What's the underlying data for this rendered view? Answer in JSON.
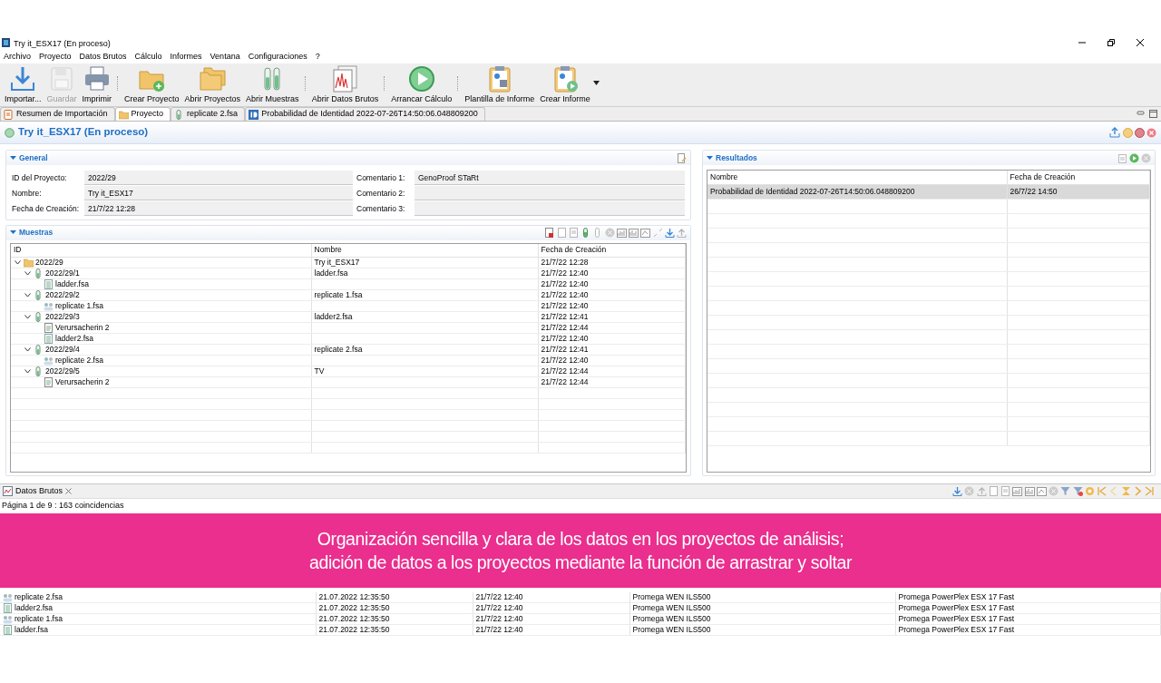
{
  "window": {
    "title": "Try it_ESX17 (En proceso)"
  },
  "menu": [
    "Archivo",
    "Proyecto",
    "Datos Brutos",
    "Cálculo",
    "Informes",
    "Ventana",
    "Configuraciones",
    "?"
  ],
  "toolbar": [
    {
      "label": "Importar...",
      "disabled": false,
      "separator_after": false
    },
    {
      "label": "Guardar",
      "disabled": true,
      "separator_after": false
    },
    {
      "label": "Imprimir",
      "disabled": false,
      "separator_after": true
    },
    {
      "label": "Crear Proyecto",
      "disabled": false,
      "separator_after": false
    },
    {
      "label": "Abrir Proyectos",
      "disabled": false,
      "separator_after": false
    },
    {
      "label": "Abrir Muestras",
      "disabled": false,
      "separator_after": true
    },
    {
      "label": "Abrir Datos Brutos",
      "disabled": false,
      "separator_after": true
    },
    {
      "label": "Arrancar Cálculo",
      "disabled": false,
      "separator_after": true
    },
    {
      "label": "Plantilla de Informe",
      "disabled": false,
      "separator_after": false
    },
    {
      "label": "Crear Informe",
      "disabled": false,
      "separator_after": false
    }
  ],
  "tabs": [
    {
      "label": "Resumen de Importación",
      "selected": false
    },
    {
      "label": "Proyecto",
      "selected": true
    },
    {
      "label": "replicate 2.fsa",
      "selected": false
    },
    {
      "label": "Probabilidad de Identidad 2022-07-26T14:50:06.048809200",
      "selected": false
    }
  ],
  "project": {
    "title": "Try it_ESX17 (En proceso)"
  },
  "general": {
    "title": "General",
    "fields": [
      {
        "label": "ID del Proyecto:",
        "value": "2022/29"
      },
      {
        "label": "Comentario 1:",
        "value": "GenoProof STaRt"
      },
      {
        "label": "Nombre:",
        "value": "Try it_ESX17"
      },
      {
        "label": "Comentario 2:"
      },
      {
        "label": "Fecha de Creación:",
        "value": "21/7/22 12:28"
      },
      {
        "label": "Comentario 3:"
      }
    ]
  },
  "muestras": {
    "title": "Muestras",
    "columns": [
      "ID",
      "Nombre",
      "Fecha de Creación"
    ],
    "rows": [
      {
        "kind": "project",
        "id": "2022/29",
        "nombre": "Try it_ESX17",
        "fecha": "21/7/22 12:28",
        "expanded": true,
        "children": [
          {
            "kind": "sample",
            "id": "2022/29/1",
            "nombre": "ladder.fsa",
            "fecha": "21/7/22 12:40",
            "expanded": true,
            "children": [
              {
                "kind": "ladder",
                "id": "ladder.fsa",
                "fecha": "21/7/22 12:40"
              }
            ]
          },
          {
            "kind": "sample",
            "id": "2022/29/2",
            "nombre": "replicate 1.fsa",
            "fecha": "21/7/22 12:40",
            "expanded": true,
            "children": [
              {
                "kind": "replicate",
                "id": "replicate 1.fsa",
                "fecha": "21/7/22 12:40"
              }
            ]
          },
          {
            "kind": "sample",
            "id": "2022/29/3",
            "nombre": "ladder2.fsa",
            "fecha": "21/7/22 12:41",
            "expanded": true,
            "children": [
              {
                "kind": "document",
                "id": "Verursacherin 2",
                "fecha": "21/7/22 12:44"
              },
              {
                "kind": "ladder",
                "id": "ladder2.fsa",
                "fecha": "21/7/22 12:40"
              }
            ]
          },
          {
            "kind": "sample",
            "id": "2022/29/4",
            "nombre": "replicate 2.fsa",
            "fecha": "21/7/22 12:41",
            "expanded": true,
            "children": [
              {
                "kind": "replicate",
                "id": "replicate 2.fsa",
                "fecha": "21/7/22 12:40"
              }
            ]
          },
          {
            "kind": "sample",
            "id": "2022/29/5",
            "nombre": "TV",
            "fecha": "21/7/22 12:44",
            "expanded": true,
            "children": [
              {
                "kind": "document",
                "id": "Verursacherin 2",
                "fecha": "21/7/22 12:44"
              }
            ]
          }
        ]
      }
    ]
  },
  "resultados": {
    "title": "Resultados",
    "columns": [
      "Nombre",
      "Fecha de Creación"
    ],
    "rows": [
      {
        "cells": [
          "Probabilidad de Identidad 2022-07-26T14:50:06.048809200",
          "26/7/22 14:50"
        ],
        "selected": true
      }
    ]
  },
  "datos_brutos": {
    "title": "Datos Brutos",
    "pagination": "Página 1 de 9 : 163 coincidencias",
    "rows": [
      {
        "kind": "replicate",
        "cells": [
          "replicate 2.fsa",
          "21.07.2022 12:35:50",
          "21/7/22 12:40",
          "Promega WEN ILS500",
          "Promega PowerPlex ESX 17 Fast"
        ]
      },
      {
        "kind": "ladder",
        "cells": [
          "ladder2.fsa",
          "21.07.2022 12:35:50",
          "21/7/22 12:40",
          "Promega WEN ILS500",
          "Promega PowerPlex ESX 17 Fast"
        ]
      },
      {
        "kind": "replicate",
        "cells": [
          "replicate 1.fsa",
          "21.07.2022 12:35:50",
          "21/7/22 12:40",
          "Promega WEN ILS500",
          "Promega PowerPlex ESX 17 Fast"
        ]
      },
      {
        "kind": "ladder",
        "cells": [
          "ladder.fsa",
          "21.07.2022 12:35:50",
          "21/7/22 12:40",
          "Promega WEN ILS500",
          "Promega PowerPlex ESX 17 Fast"
        ]
      }
    ]
  },
  "banner": {
    "lines": [
      "Organización sencilla y clara de los datos en los proyectos de análisis;",
      "adición de datos a los proyectos mediante la función de arrastrar y soltar"
    ]
  }
}
